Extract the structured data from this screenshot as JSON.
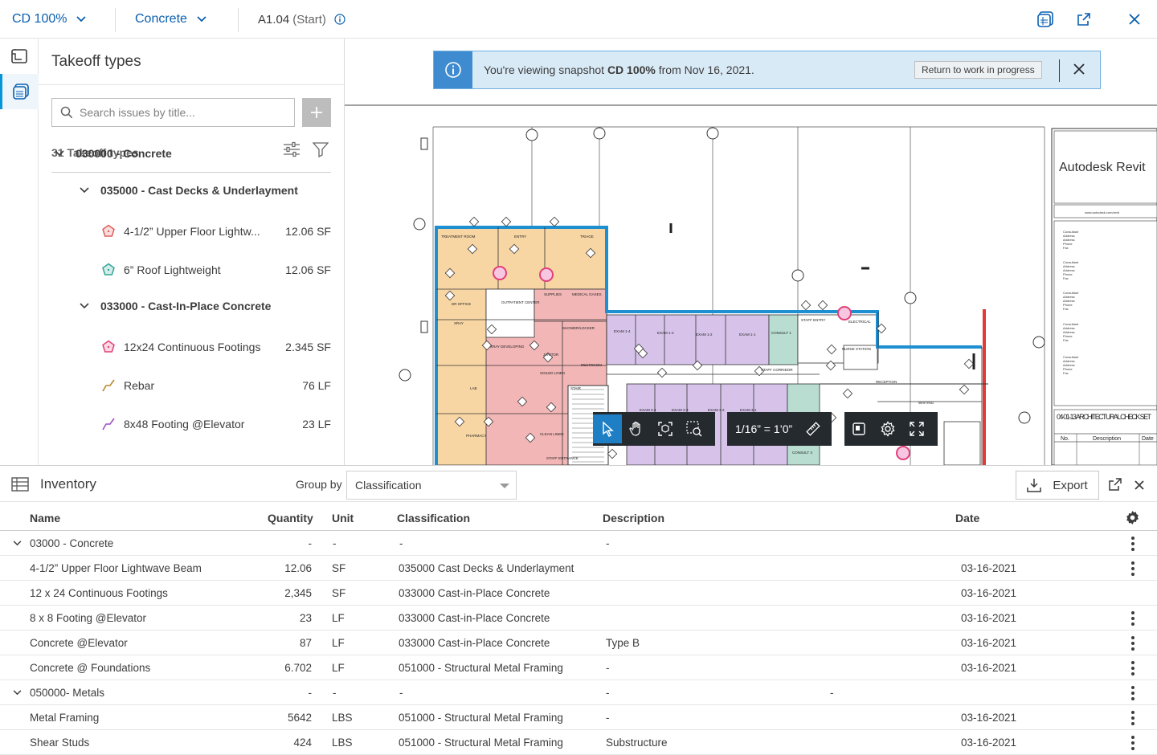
{
  "topbar": {
    "version": "CD 100%",
    "filter": "Concrete",
    "sheet_code": "A1.04",
    "sheet_suffix": "(Start)"
  },
  "panel": {
    "title": "Takeoff types",
    "search_placeholder": "Search issues by title...",
    "count_label": "31 Takeoff types",
    "tree": [
      {
        "label": "030000 - Concrete",
        "kind": "group"
      },
      {
        "label": "035000 - Cast Decks & Underlayment",
        "kind": "subgroup"
      },
      {
        "label": "4-1/2” Upper Floor Lightw...",
        "qty": "12.06 SF",
        "icon": "pentagon-icon",
        "color": "#e05c5c"
      },
      {
        "label": "6” Roof Lightweight",
        "qty": "12.06 SF",
        "icon": "pentagon-icon",
        "color": "#2ea597"
      },
      {
        "label": "033000 - Cast-In-Place Concrete",
        "kind": "subgroup"
      },
      {
        "label": "12x24 Continuous Footings",
        "qty": "2.345 SF",
        "icon": "pentagon-icon",
        "color": "#e0407a"
      },
      {
        "label": "Rebar",
        "qty": "76 LF",
        "icon": "polyline-icon",
        "color": "#b8862a"
      },
      {
        "label": "8x48 Footing @Elevator",
        "qty": "23 LF",
        "icon": "polyline-icon",
        "color": "#9b4fc9"
      }
    ]
  },
  "banner": {
    "text_pre": "You're viewing snapshot ",
    "text_bold": "CD 100%",
    "text_post": " from Nov 16, 2021.",
    "button": "Return to work in progress"
  },
  "drawing": {
    "title_block_brand": "Autodesk Revit",
    "title_block_url": "www.autodesk.com/revit",
    "sheet_name": "04-01-13 ARCHITECTURAL CHECK SET",
    "tb_col_no": "No.",
    "tb_col_desc": "Description",
    "tb_col_date": "Date",
    "scale": "1/16” = 1’0”",
    "consultant_lines": [
      "Consultant",
      "Address",
      "Address",
      "Phone",
      "Fax"
    ],
    "room_labels": [
      "TREATMENT ROOM",
      "ENTRY",
      "TRIAGE",
      "DR OFFICE",
      "OUTPATIENT CENTER",
      "SUPPLIES",
      "MEDICAL GASES",
      "XRAY",
      "XRAY DEVELOPING",
      "SHOWER/LOCKER",
      "EXAM 1-4",
      "EXAM 1-3",
      "EXAM 1-2",
      "EXAM 1-1",
      "CONSULT 1",
      "STAFF ENTRY",
      "ELECTRICAL",
      "NURSE STATION",
      "JANITOR",
      "SOILED LINEN",
      "RESTROOM",
      "LAB",
      "PHARMACY",
      "CLEAN LINEN",
      "STAFF ENTRANCE",
      "EXAM 3-4",
      "EXAM 3-3",
      "EXAM 3-2",
      "EXAM 3-1",
      "CONSULT 3",
      "RECEPTION",
      "WAITING",
      "STAFF CORRIDOR",
      "STAIR"
    ]
  },
  "inventory": {
    "title": "Inventory",
    "group_by_label": "Group by",
    "group_by_value": "Classification",
    "export_label": "Export",
    "columns": {
      "name": "Name",
      "quantity": "Quantity",
      "unit": "Unit",
      "classification": "Classification",
      "description": "Description",
      "date": "Date"
    },
    "rows": [
      {
        "group": true,
        "name": "03000 - Concrete",
        "quantity": "-",
        "unit": "-",
        "classification": "-",
        "description": "-",
        "date": ""
      },
      {
        "name": "4-1/2” Upper Floor Lightwave Beam",
        "quantity": "12.06",
        "unit": "SF",
        "classification": "035000 Cast Decks & Underlayment",
        "description": "",
        "date": "03-16-2021"
      },
      {
        "name": "12 x 24 Continuous Footings",
        "quantity": "2,345",
        "unit": "SF",
        "classification": "033000 Cast-in-Place Concrete",
        "description": "",
        "date": "03-16-2021"
      },
      {
        "name": "8 x 8 Footing @Elevator",
        "quantity": "23",
        "unit": "LF",
        "classification": "033000 Cast-in-Place Concrete",
        "description": "",
        "date": "03-16-2021"
      },
      {
        "name": "Concrete @Elevator",
        "quantity": "87",
        "unit": "LF",
        "classification": "033000 Cast-in-Place Concrete",
        "description": "Type B",
        "date": "03-16-2021"
      },
      {
        "name": "Concrete @ Foundations",
        "quantity": "6.702",
        "unit": "LF",
        "classification": "051000 - Structural Metal Framing",
        "description": "-",
        "date": "03-16-2021"
      },
      {
        "group": true,
        "name": "050000- Metals",
        "quantity": "-",
        "unit": "-",
        "classification": "-",
        "description": "-",
        "extra": "-",
        "date": ""
      },
      {
        "name": "Metal Framing",
        "quantity": "5642",
        "unit": "LBS",
        "classification": "051000 - Structural Metal Framing",
        "description": "-",
        "date": "03-16-2021"
      },
      {
        "name": "Shear Studs",
        "quantity": "424",
        "unit": "LBS",
        "classification": "051000 - Structural Metal Framing",
        "description": "Substructure",
        "date": "03-16-2021"
      }
    ]
  }
}
